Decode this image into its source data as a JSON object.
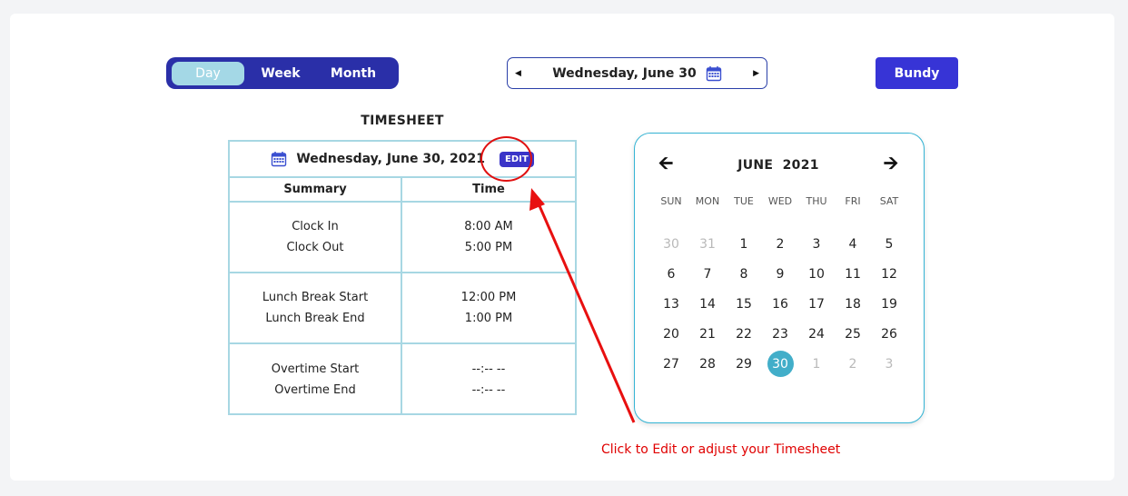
{
  "view_toggle": {
    "options": [
      {
        "label": "Day",
        "active": true
      },
      {
        "label": "Week",
        "active": false
      },
      {
        "label": "Month",
        "active": false
      }
    ]
  },
  "date_nav": {
    "current_date": "Wednesday, June 30",
    "prev_icon": "caret-left-icon",
    "next_icon": "caret-right-icon",
    "calendar_icon": "calendar-icon"
  },
  "bundy_label": "Bundy",
  "timesheet": {
    "title": "TIMESHEET",
    "date": "Wednesday, June 30, 2021",
    "edit_label": "EDIT",
    "col_summary": "Summary",
    "col_time": "Time",
    "rows": [
      {
        "summary": [
          "Clock In",
          "Clock Out"
        ],
        "time": [
          "8:00 AM",
          "5:00 PM"
        ]
      },
      {
        "summary": [
          "Lunch Break Start",
          "Lunch Break End"
        ],
        "time": [
          "12:00 PM",
          "1:00 PM"
        ]
      },
      {
        "summary": [
          "Overtime Start",
          "Overtime End"
        ],
        "time": [
          "--:-- --",
          "--:-- --"
        ]
      }
    ]
  },
  "calendar": {
    "month_label": "JUNE  2021",
    "prev_icon": "arrow-left-icon",
    "next_icon": "arrow-right-icon",
    "weekdays": [
      "SUN",
      "MON",
      "TUE",
      "WED",
      "THU",
      "FRI",
      "SAT"
    ],
    "days": [
      {
        "d": "30",
        "muted": true
      },
      {
        "d": "31",
        "muted": true
      },
      {
        "d": "1"
      },
      {
        "d": "2"
      },
      {
        "d": "3"
      },
      {
        "d": "4"
      },
      {
        "d": "5"
      },
      {
        "d": "6"
      },
      {
        "d": "7"
      },
      {
        "d": "8"
      },
      {
        "d": "9"
      },
      {
        "d": "10"
      },
      {
        "d": "11"
      },
      {
        "d": "12"
      },
      {
        "d": "13"
      },
      {
        "d": "14"
      },
      {
        "d": "15"
      },
      {
        "d": "16"
      },
      {
        "d": "17"
      },
      {
        "d": "18"
      },
      {
        "d": "19"
      },
      {
        "d": "20"
      },
      {
        "d": "21"
      },
      {
        "d": "22"
      },
      {
        "d": "23"
      },
      {
        "d": "24"
      },
      {
        "d": "25"
      },
      {
        "d": "26"
      },
      {
        "d": "27"
      },
      {
        "d": "28"
      },
      {
        "d": "29"
      },
      {
        "d": "30",
        "selected": true
      },
      {
        "d": "1",
        "muted": true
      },
      {
        "d": "2",
        "muted": true
      },
      {
        "d": "3",
        "muted": true
      }
    ],
    "selected_color": "#42aec9"
  },
  "annotation": {
    "text": "Click to Edit or adjust your Timesheet",
    "color": "#e00000"
  },
  "colors": {
    "primary": "#3734d6",
    "toggle_bg": "#2a2fa8",
    "toggle_active": "#a4d8e6",
    "table_border": "#a7d7e3"
  }
}
